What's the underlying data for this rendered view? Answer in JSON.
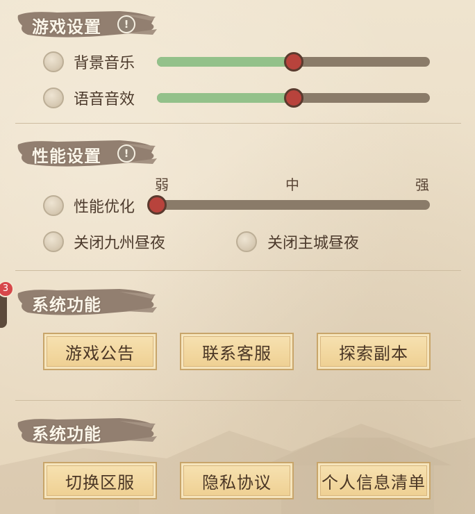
{
  "sections": {
    "game": {
      "title": "游戏设置"
    },
    "perf": {
      "title": "性能设置"
    },
    "sys1": {
      "title": "系统功能"
    },
    "sys2": {
      "title": "系统功能"
    }
  },
  "game": {
    "bgm": {
      "label": "背景音乐",
      "value": 0.5
    },
    "sfx": {
      "label": "语音音效",
      "value": 0.5
    }
  },
  "perf": {
    "optimize": {
      "label": "性能优化",
      "level": 0.0
    },
    "ticks": {
      "low": "弱",
      "mid": "中",
      "high": "强"
    },
    "toggle_day_night_jiuzhou": "关闭九州昼夜",
    "toggle_day_night_maincity": "关闭主城昼夜"
  },
  "sys1_buttons": [
    "游戏公告",
    "联系客服",
    "探索副本"
  ],
  "sys2_buttons": [
    "切换区服",
    "隐私协议",
    "个人信息清单"
  ],
  "badge_count": "3",
  "icons": {
    "info": "!"
  },
  "colors": {
    "slider_fill": "#93c18a",
    "knob": "#b8433c",
    "button_bg": "#eecf91"
  }
}
